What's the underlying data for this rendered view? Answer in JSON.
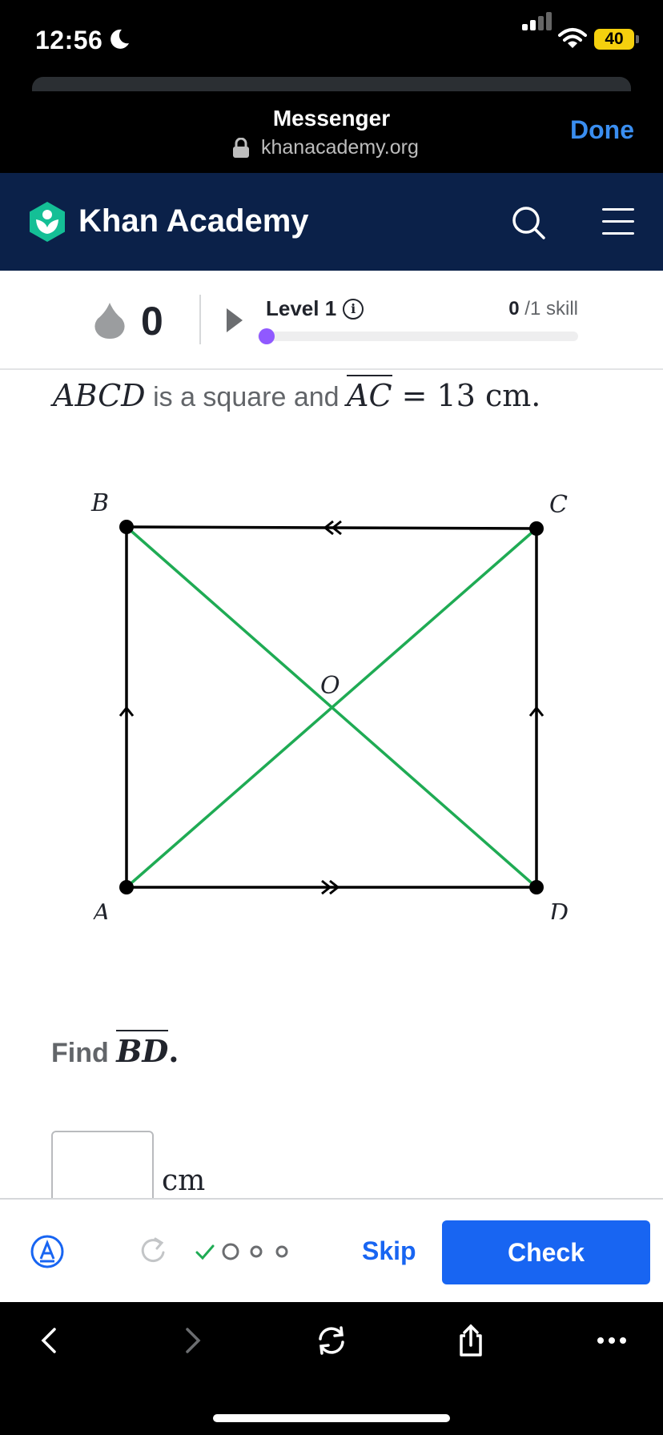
{
  "status_bar": {
    "time": "12:56",
    "battery": "40"
  },
  "sheet": {
    "title": "Messenger",
    "url": "khanacademy.org",
    "done_label": "Done"
  },
  "nav": {
    "brand": "Khan Academy"
  },
  "progress": {
    "streak": "0",
    "level_label": "Level 1",
    "skills_done": "0",
    "skills_total": " /1 skill",
    "fraction": 0.0
  },
  "question": {
    "shape": "ABCD",
    "text_mid": " is a square and ",
    "segment": "AC",
    "equals": " = 13 cm."
  },
  "diagram": {
    "labels": {
      "A": "A",
      "B": "B",
      "C": "C",
      "D": "D",
      "O": "O"
    },
    "colors": {
      "side": "#000000",
      "diagonal": "#1fab54"
    }
  },
  "find": {
    "prefix": "Find ",
    "segment": "BD",
    "suffix": "."
  },
  "answer": {
    "value": "",
    "unit": "cm"
  },
  "toolbar": {
    "skip_label": "Skip",
    "check_label": "Check"
  },
  "colors": {
    "brand_blue": "#1865f2",
    "nav_bg": "#0b2149",
    "progress_purple": "#9059ff",
    "battery": "#f5d00e"
  }
}
